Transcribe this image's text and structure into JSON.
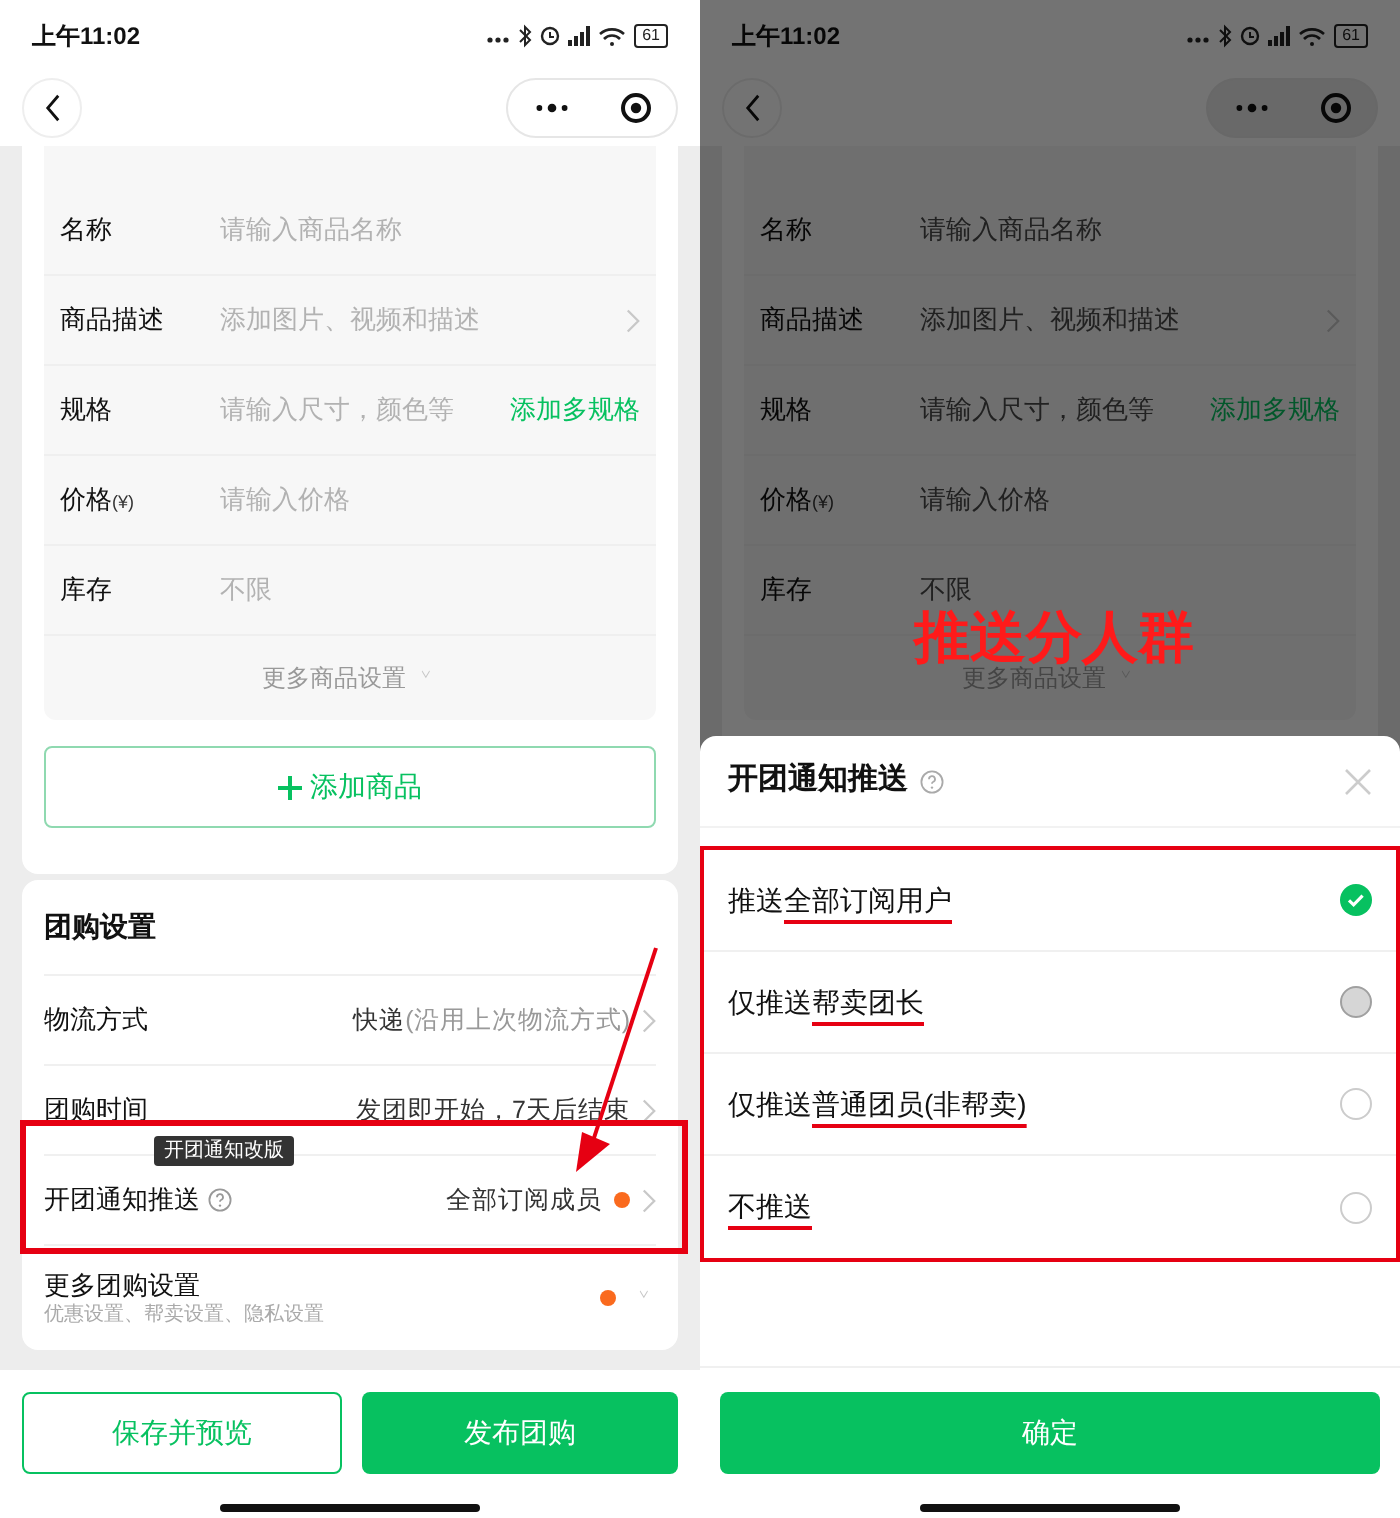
{
  "left_screen": {
    "status_bar": {
      "time": "上午11:02",
      "battery": "61"
    },
    "product_rows": [
      {
        "kind": "text",
        "label": "名称",
        "placeholder": "请输入商品名称"
      },
      {
        "kind": "link",
        "label": "商品描述",
        "placeholder": "添加图片、视频和描述"
      },
      {
        "kind": "action",
        "label": "规格",
        "placeholder": "请输入尺寸，颜色等",
        "action": "添加多规格"
      },
      {
        "kind": "price",
        "label": "价格",
        "unit": "(¥)",
        "placeholder": "请输入价格"
      },
      {
        "kind": "text",
        "label": "库存",
        "placeholder": "不限"
      }
    ],
    "more_product_settings": "更多商品设置",
    "add_product_button": "添加商品",
    "group_settings": {
      "title": "团购设置",
      "rows": [
        {
          "kind": "link",
          "label": "物流方式",
          "value": "快递",
          "value_note": "(沿用上次物流方式)"
        },
        {
          "kind": "link",
          "label": "团购时间",
          "value": "发团即开始，7天后结束"
        },
        {
          "kind": "help",
          "label": "开团通知推送",
          "value": "全部订阅成员",
          "tooltip": "开团通知改版",
          "dot": true,
          "highlighted": true
        }
      ],
      "more": {
        "title": "更多团购设置",
        "subtitle": "优惠设置、帮卖设置、隐私设置",
        "dot": true
      }
    },
    "footer_buttons": [
      {
        "label": "保存并预览",
        "kind": "outline"
      },
      {
        "label": "发布团购",
        "kind": "primary"
      }
    ]
  },
  "right_screen": {
    "status_bar": {
      "time": "上午11:02",
      "battery": "61"
    },
    "product_rows": [
      {
        "kind": "text",
        "label": "名称",
        "placeholder": "请输入商品名称"
      },
      {
        "kind": "link",
        "label": "商品描述",
        "placeholder": "添加图片、视频和描述"
      },
      {
        "kind": "action",
        "label": "规格",
        "placeholder": "请输入尺寸，颜色等",
        "action": "添加多规格"
      },
      {
        "kind": "price",
        "label": "价格",
        "unit": "(¥)",
        "placeholder": "请输入价格"
      },
      {
        "kind": "text",
        "label": "库存",
        "placeholder": "不限"
      }
    ],
    "more_product_settings": "更多商品设置",
    "annotation": "推送分人群",
    "sheet": {
      "title": "开团通知推送",
      "options": [
        {
          "lead": "推送",
          "underlined": "全部订阅用户",
          "selected": true,
          "disabled": false
        },
        {
          "lead": "仅推送",
          "underlined": "帮卖团长",
          "selected": false,
          "disabled": true
        },
        {
          "lead": "仅推送",
          "underlined": "普通团员(非帮卖)",
          "selected": false,
          "disabled": false
        },
        {
          "underlined": "不推送",
          "selected": false,
          "disabled": false
        }
      ],
      "confirm_button": "确定"
    }
  }
}
